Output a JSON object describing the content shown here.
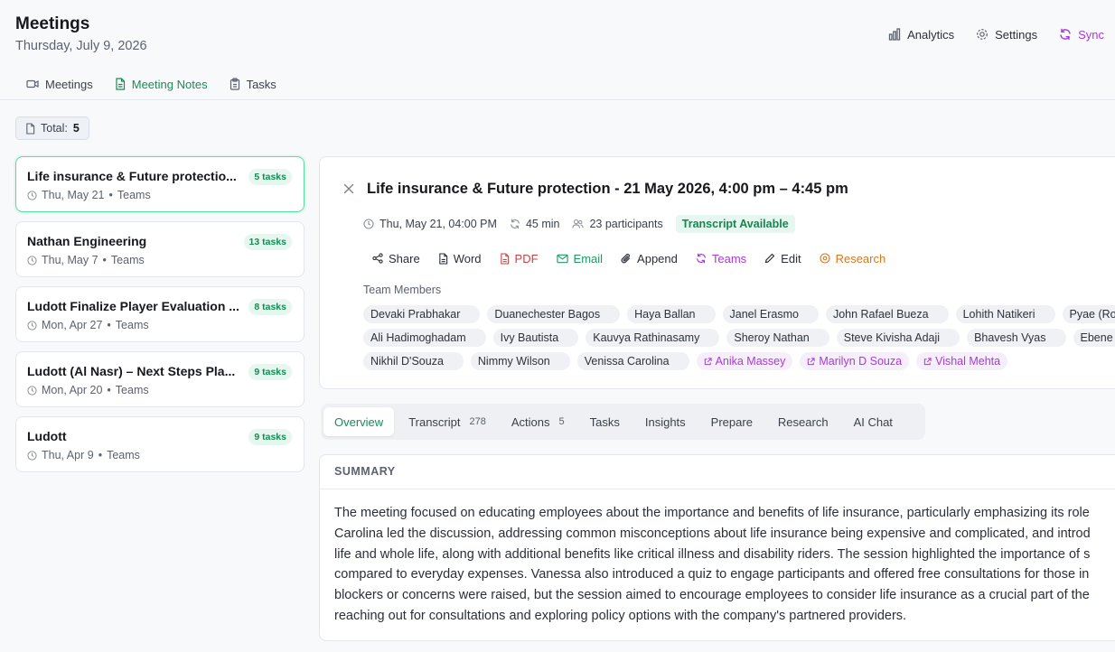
{
  "header": {
    "title": "Meetings",
    "date": "Thursday, July 9, 2026",
    "actions": [
      {
        "label": "Analytics",
        "icon": "bar-chart-icon"
      },
      {
        "label": "Settings",
        "icon": "gear-icon"
      },
      {
        "label": "Sync",
        "icon": "sync-icon",
        "color": "#a93ad6"
      }
    ]
  },
  "tabs": [
    {
      "label": "Meetings",
      "icon": "video-icon"
    },
    {
      "label": "Meeting Notes",
      "icon": "document-icon",
      "active": true
    },
    {
      "label": "Tasks",
      "icon": "clipboard-icon"
    }
  ],
  "total": {
    "label": "Total:",
    "value": "5"
  },
  "meetings": [
    {
      "title": "Life insurance & Future protectio...",
      "date": "Thu, May 21",
      "platform": "Teams",
      "tasks": "5 tasks",
      "selected": true
    },
    {
      "title": "Nathan Engineering",
      "date": "Thu, May 7",
      "platform": "Teams",
      "tasks": "13 tasks"
    },
    {
      "title": "Ludott Finalize Player Evaluation ...",
      "date": "Mon, Apr 27",
      "platform": "Teams",
      "tasks": "8 tasks"
    },
    {
      "title": "Ludott (Al Nasr) – Next Steps Pla...",
      "date": "Mon, Apr 20",
      "platform": "Teams",
      "tasks": "9 tasks"
    },
    {
      "title": "Ludott",
      "date": "Thu, Apr 9",
      "platform": "Teams",
      "tasks": "9 tasks"
    }
  ],
  "detail": {
    "title": "Life insurance & Future protection - 21 May 2026, 4:00 pm – 4:45 pm",
    "datetime": "Thu, May 21, 04:00 PM",
    "duration": "45 min",
    "participants": "23 participants",
    "transcript_status": "Transcript Available",
    "actions": [
      "Share",
      "Word",
      "PDF",
      "Email",
      "Append",
      "Teams",
      "Edit",
      "Research"
    ],
    "team_label": "Team Members",
    "team_rows": [
      [
        "Devaki Prabhakar",
        "Duanechester Bagos",
        "Haya Ballan",
        "Janel Erasmo",
        "John Rafael Bueza",
        "Lohith Natikeri",
        "Pyae (Ro"
      ],
      [
        "Ali Hadimoghadam",
        "Ivy Bautista",
        "Kauvya Rathinasamy",
        "Sheroy Nathan",
        "Steve Kivisha Adaji",
        "Bhavesh Vyas",
        "Ebene"
      ],
      [
        "Nikhil D'Souza",
        "Nimmy Wilson",
        "Venissa Carolina"
      ]
    ],
    "external_members": [
      "Anika Massey",
      "Marilyn D Souza",
      "Vishal Mehta"
    ]
  },
  "content_tabs": [
    {
      "label": "Overview",
      "active": true
    },
    {
      "label": "Transcript",
      "count": "278"
    },
    {
      "label": "Actions",
      "count": "5"
    },
    {
      "label": "Tasks"
    },
    {
      "label": "Insights"
    },
    {
      "label": "Prepare"
    },
    {
      "label": "Research"
    },
    {
      "label": "AI Chat"
    }
  ],
  "summary": {
    "label": "SUMMARY",
    "lines": [
      "The meeting focused on educating employees about the importance and benefits of life insurance, particularly emphasizing its role",
      "Carolina led the discussion, addressing common misconceptions about life insurance being expensive and complicated, and introd",
      "life and whole life, along with additional benefits like critical illness and disability riders. The session highlighted the importance of s",
      "compared to everyday expenses. Vanessa also introduced a quiz to engage participants and offered free consultations for those in",
      "blockers or concerns were raised, but the session aimed to encourage employees to consider life insurance as a crucial part of the",
      "reaching out for consultations and exploring policy options with the company's partnered providers."
    ]
  }
}
